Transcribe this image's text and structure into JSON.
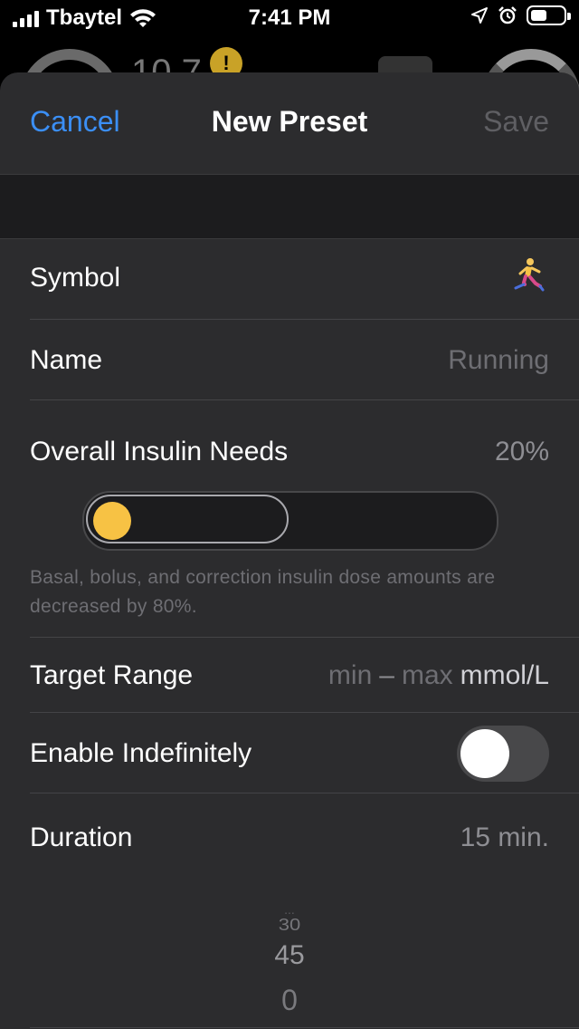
{
  "status_bar": {
    "carrier": "Tbaytel",
    "time": "7:41 PM",
    "battery_level": 0.5
  },
  "underlay": {
    "glucose_partial": "10.7",
    "warning_glyph": "!"
  },
  "nav": {
    "cancel_label": "Cancel",
    "title": "New Preset",
    "save_label": "Save"
  },
  "rows": {
    "symbol_label": "Symbol",
    "symbol_icon": "running-emoji",
    "name_label": "Name",
    "name_placeholder": "Running",
    "insulin_label": "Overall Insulin Needs",
    "insulin_value": "20%",
    "insulin_level": 0.2,
    "insulin_note": "Basal, bolus, and correction insulin dose amounts are decreased by 80%.",
    "target_label": "Target Range",
    "target_min": "min",
    "target_dash": "–",
    "target_max": "max",
    "target_unit": "mmol/L",
    "enable_label": "Enable Indefinitely",
    "enable_on": false,
    "duration_label": "Duration",
    "duration_value": "15 min."
  },
  "picker": {
    "items": [
      "...",
      "30",
      "45",
      "0"
    ]
  },
  "colors": {
    "accent_blue": "#3b8ff6",
    "slider_yellow": "#f7c244",
    "sheet_bg": "#2c2c2e"
  }
}
